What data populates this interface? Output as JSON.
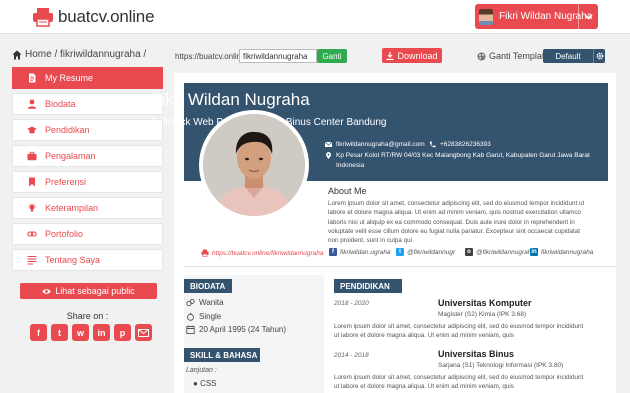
{
  "header": {
    "logo_text": "buatcv.online",
    "user_name": "Fikri Wildan Nugraha",
    "brand_color": "#e84a4f"
  },
  "toolbar": {
    "breadcrumb_home": "Home",
    "breadcrumb_page": "/ fikriwildannugraha /",
    "url_prefix": "https://buatcv.online/",
    "url_value": "fikriwildannugraha",
    "ganti_label": "Ganti",
    "download_label": "Download",
    "template_label": "Ganti Template :",
    "template_value": "Default"
  },
  "sidebar": {
    "items": [
      {
        "label": "My Resume",
        "icon": "document-icon"
      },
      {
        "label": "Biodata",
        "icon": "user-icon"
      },
      {
        "label": "Pendidikan",
        "icon": "graduation-cap-icon"
      },
      {
        "label": "Pengalaman",
        "icon": "briefcase-icon"
      },
      {
        "label": "Preferensi",
        "icon": "bookmark-icon"
      },
      {
        "label": "Keterampilan",
        "icon": "bulb-icon"
      },
      {
        "label": "Portofolio",
        "icon": "link-icon"
      },
      {
        "label": "Tentang Saya",
        "icon": "lines-icon"
      }
    ],
    "view_public_label": "Lihat sebagai public",
    "share_label": "Share on :",
    "share_icons": [
      "facebook-icon",
      "twitter-icon",
      "whatsapp-icon",
      "linkedin-icon",
      "pinterest-icon",
      "email-icon"
    ]
  },
  "resume": {
    "name": "Fikri Wildan Nugraha",
    "job_title": "Fullstack Web Programmer at Binus Center Bandung",
    "email": "fikriwildannugraha@gmail.com",
    "phone": "+6283826236393",
    "address_line1": "Kp Pesar Kolot RT/RW 04/03 Kec Malangbong Kab Garut, Kabupaten Garut Jawa Barat",
    "address_line2": "Indonesia",
    "about_title": "About Me",
    "about_text": "Lorem ipsum dolor sit amet, consectetur adipiscing elit, sed do eiusmod tempor incididunt ut labore et dolore magna aliqua. Ut enim ad minim veniam, quis nostrud exercitation ullamco laboris nisi ut aliquip ex ea commodo consequat. Duis aute irure dolor in reprehenderit in voluptate velit esse cillum dolore eu fugiat nulla pariatur. Excepteur sint occaecat cupidatat non proident, sunt in culpa qui",
    "website": "https://buatcv.online/fikriwildannugraha",
    "social": [
      {
        "label": "fikriwildan.ugraha",
        "icon": "facebook-icon",
        "color": "#3b5998"
      },
      {
        "label": "@fikriwildannugr",
        "icon": "twitter-icon",
        "color": "#1da1f2"
      },
      {
        "label": "@fikriwildannugraha",
        "icon": "instagram-icon",
        "color": "#444444"
      },
      {
        "label": "fikriwildannugraha",
        "icon": "linkedin-icon",
        "color": "#0077b5"
      }
    ],
    "biodata_title": "BIODATA",
    "gender": "Wanita",
    "marital": "Single",
    "birth": "20 April 1995 (24 Tahun)",
    "skill_title": "SKILL & BAHASA",
    "skill_sub": "Lanjutan :",
    "skills": [
      "CSS"
    ],
    "education_title": "PENDIDIKAN",
    "education": [
      {
        "date": "2018 - 2020",
        "school": "Universitas Komputer",
        "degree": "Magister (S2) Kimia (IPK 3.68)",
        "desc": "Lorem ipsum dolor sit amet, consectetur adipiscing elit, sed do eiusmod tempor incididunt ut labore et dolore magna aliqua. Ut enim ad minim veniam, quis"
      },
      {
        "date": "2014 - 2018",
        "school": "Universitas Binus",
        "degree": "Sarjana (S1) Teknologi Informasi (IPK 3.80)",
        "desc": "Lorem ipsum dolor sit amet, consectetur adipiscing elit, sed do eiusmod tempor incididunt ut labore et dolore magna aliqua. Ut enim ad minim veniam, quis"
      }
    ]
  }
}
